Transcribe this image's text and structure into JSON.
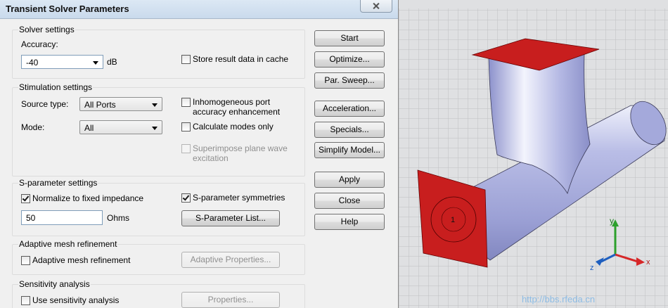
{
  "dialog": {
    "title": "Transient Solver Parameters",
    "solver": {
      "heading": "Solver settings",
      "accuracy_label": "Accuracy:",
      "accuracy_value": "-40",
      "accuracy_unit": "dB",
      "store_cache_label": "Store result data in cache"
    },
    "stimulation": {
      "heading": "Stimulation settings",
      "source_type_label": "Source type:",
      "source_type_value": "All Ports",
      "mode_label": "Mode:",
      "mode_value": "All",
      "inhomogeneous_line1": "Inhomogeneous port",
      "inhomogeneous_line2": "accuracy enhancement",
      "calc_modes_label": "Calculate modes only",
      "superimpose_line1": "Superimpose plane wave",
      "superimpose_line2": "excitation"
    },
    "sparam": {
      "heading": "S-parameter settings",
      "normalize_label": "Normalize to fixed impedance",
      "impedance_value": "50",
      "impedance_unit": "Ohms",
      "symmetries_label": "S-parameter symmetries",
      "list_button": "S-Parameter List..."
    },
    "adaptive": {
      "heading": "Adaptive mesh refinement",
      "checkbox_label": "Adaptive mesh refinement",
      "properties_button": "Adaptive Properties..."
    },
    "sensitivity": {
      "heading": "Sensitivity analysis",
      "checkbox_label": "Use sensitivity analysis",
      "properties_button": "Properties..."
    },
    "buttons": {
      "start": "Start",
      "optimize": "Optimize...",
      "par_sweep": "Par. Sweep...",
      "acceleration": "Acceleration...",
      "specials": "Specials...",
      "simplify": "Simplify Model...",
      "apply": "Apply",
      "close": "Close",
      "help": "Help"
    }
  },
  "view3d": {
    "port_label": "1",
    "axis_x": "x",
    "axis_y": "y",
    "axis_z": "z",
    "watermark": "http://bbs.rfeda.cn",
    "colors": {
      "port": "#c81e1e",
      "pipe": "#a2a8dc",
      "grid_bg": "#dfe0e2",
      "axis_y": "#2ca02c",
      "axis_x": "#d62728",
      "axis_z": "#1f5fbf"
    }
  }
}
